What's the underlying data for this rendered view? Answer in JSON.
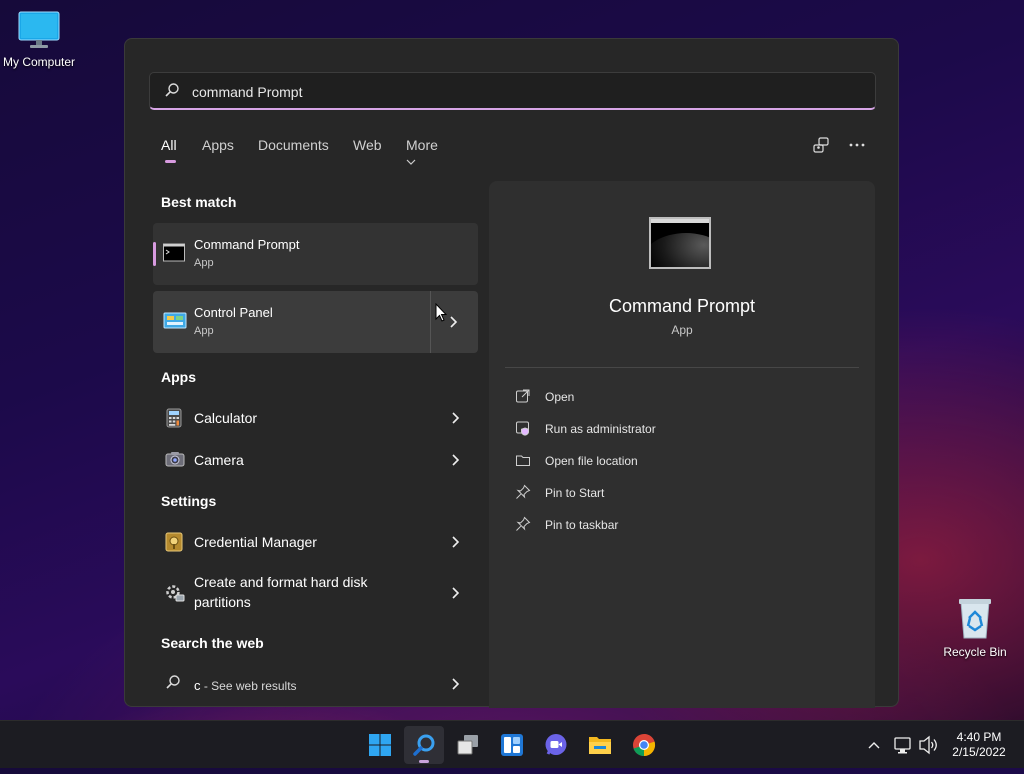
{
  "desktop": {
    "icons": [
      {
        "label": "My Computer"
      },
      {
        "label": "Recycle Bin"
      }
    ]
  },
  "search": {
    "value": "command Prompt",
    "tabs": [
      "All",
      "Apps",
      "Documents",
      "Web",
      "More"
    ],
    "active_tab": "All"
  },
  "results": {
    "best_match_heading": "Best match",
    "best_match": [
      {
        "title": "Command Prompt",
        "subtitle": "App",
        "icon": "command-prompt-icon"
      },
      {
        "title": "Control Panel",
        "subtitle": "App",
        "icon": "control-panel-icon"
      }
    ],
    "apps_heading": "Apps",
    "apps": [
      {
        "label": "Calculator",
        "icon": "calculator-icon"
      },
      {
        "label": "Camera",
        "icon": "camera-icon"
      }
    ],
    "settings_heading": "Settings",
    "settings": [
      {
        "label": "Credential Manager",
        "icon": "credential-manager-icon"
      },
      {
        "label_line1": "Create and format hard disk",
        "label_line2": "partitions",
        "icon": "disk-management-icon"
      }
    ],
    "web_heading": "Search the web",
    "web": {
      "query": "c",
      "suffix": " - See web results"
    }
  },
  "detail": {
    "title": "Command Prompt",
    "subtitle": "App",
    "actions": [
      {
        "label": "Open",
        "icon": "open-icon"
      },
      {
        "label": "Run as administrator",
        "icon": "run-as-admin-icon"
      },
      {
        "label": "Open file location",
        "icon": "folder-icon"
      },
      {
        "label": "Pin to Start",
        "icon": "pin-icon"
      },
      {
        "label": "Pin to taskbar",
        "icon": "pin-icon"
      }
    ]
  },
  "taskbar": {
    "apps": [
      "start-icon",
      "search-icon",
      "task-view-icon",
      "widgets-icon",
      "chat-icon",
      "file-explorer-icon",
      "chrome-icon"
    ],
    "time": "4:40 PM",
    "date": "2/15/2022"
  },
  "colors": {
    "accent": "#d89be0",
    "panel": "#272727",
    "detail_panel": "#2f2f2f"
  }
}
